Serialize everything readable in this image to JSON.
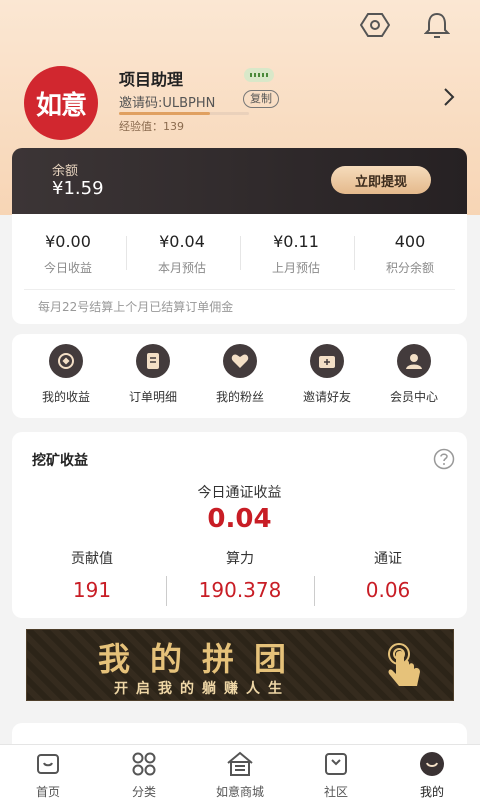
{
  "header": {
    "settings_icon": "gear-hex-icon",
    "notification_icon": "bell-icon"
  },
  "profile": {
    "logo_text": "如意",
    "name": "项目助理",
    "invite_code": "邀请码:ULBPHN",
    "copy_label": "复制",
    "exp_text": "经验值：139",
    "exp_progress": 0.7
  },
  "balance": {
    "label": "余额",
    "value": "¥1.59",
    "withdraw_label": "立即提现"
  },
  "stats": {
    "items": [
      {
        "value": "¥0.00",
        "label": "今日收益"
      },
      {
        "value": "¥0.04",
        "label": "本月预估"
      },
      {
        "value": "¥0.11",
        "label": "上月预估"
      },
      {
        "value": "400",
        "label": "积分余额"
      }
    ],
    "note": "每月22号结算上个月已结算订单佣金"
  },
  "menu": {
    "items": [
      {
        "label": "我的收益",
        "icon": "coin-icon"
      },
      {
        "label": "订单明细",
        "icon": "document-icon"
      },
      {
        "label": "我的粉丝",
        "icon": "heart-icon"
      },
      {
        "label": "邀请好友",
        "icon": "invite-icon"
      },
      {
        "label": "会员中心",
        "icon": "member-icon"
      }
    ]
  },
  "mining": {
    "title": "挖矿收益",
    "today_label": "今日通证收益",
    "today_value": "0.04",
    "columns": [
      {
        "label": "贡献值",
        "value": "191"
      },
      {
        "label": "算力",
        "value": "190.378"
      },
      {
        "label": "通证",
        "value": "0.06"
      }
    ]
  },
  "banner": {
    "title": "我的拼团",
    "subtitle": "开启我的躺赚人生"
  },
  "tabbar": {
    "items": [
      {
        "label": "首页",
        "icon": "home-icon"
      },
      {
        "label": "分类",
        "icon": "category-icon"
      },
      {
        "label": "如意商城",
        "icon": "mall-icon"
      },
      {
        "label": "社区",
        "icon": "community-icon"
      },
      {
        "label": "我的",
        "icon": "profile-icon",
        "active": true
      }
    ]
  },
  "colors": {
    "accent_red": "#c81d25",
    "dark_card": "#2e2829",
    "gold": "#e4b98c"
  }
}
